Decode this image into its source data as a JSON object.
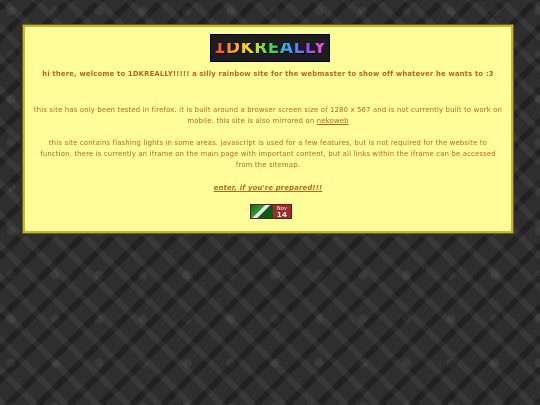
{
  "header": {
    "logo_text": "1DKREALLY"
  },
  "content": {
    "intro_prefix": "hi there, welcome to ",
    "site_name": "1DKREALLY!!!!!",
    "intro_suffix": " a silly rainbow site for the webmaster to show off whatever he wants to :3",
    "tested_prefix": "this site has only been tested in firefox. it is built around a browser screen size of 1280 x 567 and is not currently built to work on mobile. this site is also mirrored on ",
    "mirror_link": "nekoweb",
    "warning": "this site contains flashing lights in some areas. javascript is used for a few features, but is not required for the website to function. there is currently an iframe on the main page with important content, but all links within the iframe can be accessed from the sitemap.",
    "enter_link": "enter, if you're prepared!!!"
  },
  "badge": {
    "month": "Nov",
    "day": "14"
  },
  "colors": {
    "panel_bg": "#fffd9a",
    "panel_border": "#c8b33a",
    "text": "#b8651c",
    "background": "#2e2e2e"
  }
}
